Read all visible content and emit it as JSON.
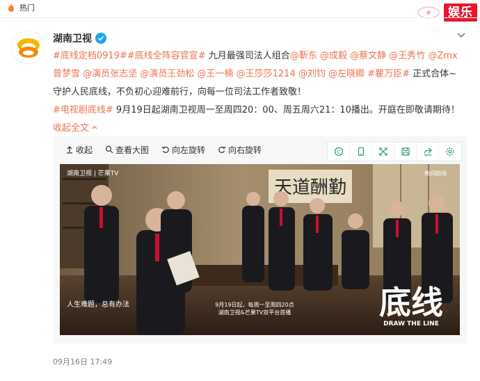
{
  "topbar": {
    "hot_label": "热门",
    "corner_tag": "娱乐"
  },
  "post": {
    "author": "湖南卫视",
    "text_segments": [
      {
        "text": "#底线定档0919#",
        "type": "tag"
      },
      {
        "text": "#底线全阵容官宣#",
        "type": "tag"
      },
      {
        "text": " 九月最强司法人组合",
        "type": "text"
      },
      {
        "text": "@靳东",
        "type": "link"
      },
      {
        "text": " ",
        "type": "text"
      },
      {
        "text": "@成毅",
        "type": "link"
      },
      {
        "text": " ",
        "type": "text"
      },
      {
        "text": "@蔡文静",
        "type": "link"
      },
      {
        "text": " ",
        "type": "text"
      },
      {
        "text": "@王秀竹",
        "type": "link"
      },
      {
        "text": " ",
        "type": "text"
      },
      {
        "text": "@Zmx曾梦雪",
        "type": "link"
      },
      {
        "text": " ",
        "type": "text"
      },
      {
        "text": "@演员张志坚",
        "type": "link"
      },
      {
        "text": " ",
        "type": "text"
      },
      {
        "text": "@演员王劲松",
        "type": "link"
      },
      {
        "text": " ",
        "type": "text"
      },
      {
        "text": "@王一楠",
        "type": "link"
      },
      {
        "text": " ",
        "type": "text"
      },
      {
        "text": "@王莎莎1214",
        "type": "link"
      },
      {
        "text": " ",
        "type": "text"
      },
      {
        "text": "@刘钧",
        "type": "link"
      },
      {
        "text": " ",
        "type": "text"
      },
      {
        "text": "@左晓卿",
        "type": "link"
      },
      {
        "text": " ",
        "type": "text"
      },
      {
        "text": "#瞿万臣#",
        "type": "tag"
      },
      {
        "text": " 正式合体~守护人民底线，不负初心迎难前行，向每一位司法工作者致敬！",
        "type": "text"
      },
      {
        "text": "",
        "type": "br"
      },
      {
        "text": "#电视剧底线#",
        "type": "tag"
      },
      {
        "text": " 9月19日起湖南卫视周一至周四20：00、周五周六21：10播出。开庭在即敬请期待！",
        "type": "text"
      },
      {
        "text": " 收起全文",
        "type": "link"
      }
    ],
    "timestamp": "09月16日 17:49"
  },
  "media_toolbar": {
    "collapse": "收起",
    "view_large": "查看大图",
    "rotate_left": "向左旋转",
    "rotate_right": "向右旋转",
    "icons": [
      "weibo-icon",
      "phone-icon",
      "fullscreen-icon",
      "save-icon",
      "share-icon",
      "settings-icon"
    ]
  },
  "poster": {
    "channel_logo": "湖南卫视",
    "partner_logo": "芒果TV",
    "calligraphy": "天道酬勤",
    "slogan": "人生难题，总有办法",
    "air_info_line1": "9月19日起，每周一至周四20点",
    "air_info_line2": "湖南卫视&芒果TV双平台首播",
    "title_cn": "底线",
    "title_en": "DRAW THE LINE",
    "badge": "晚间剧场"
  },
  "colors": {
    "accent": "#eb7350",
    "verified": "#1ea2f5",
    "corner_tag": "#e6162d"
  }
}
